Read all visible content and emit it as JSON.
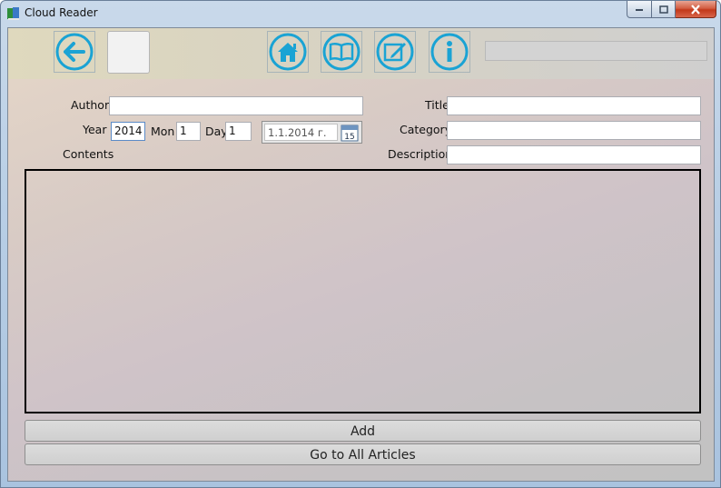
{
  "window": {
    "title": "Cloud Reader"
  },
  "toolbar": {
    "back": "back-arrow-icon",
    "home": "home-icon",
    "library": "open-book-icon",
    "edit": "edit-note-icon",
    "info": "info-icon",
    "search_value": ""
  },
  "form": {
    "author_label": "Author:",
    "author_value": "",
    "year_label": "Year",
    "year_value": "2014",
    "mon_label": "Mon",
    "mon_value": "1",
    "day_label": "Day",
    "day_value": "1",
    "date_value": "1.1.2014 г.",
    "calendar_day": "15",
    "contents_label": "Contents",
    "title_label": "Title",
    "title_value": "",
    "category_label": "Category",
    "category_value": "",
    "description_label": "Description",
    "description_value": "",
    "contents_value": ""
  },
  "actions": {
    "add_label": "Add",
    "all_articles_label": "Go to All Articles"
  },
  "colors": {
    "accent": "#1aa3d4",
    "close_button": "#c2381b"
  }
}
